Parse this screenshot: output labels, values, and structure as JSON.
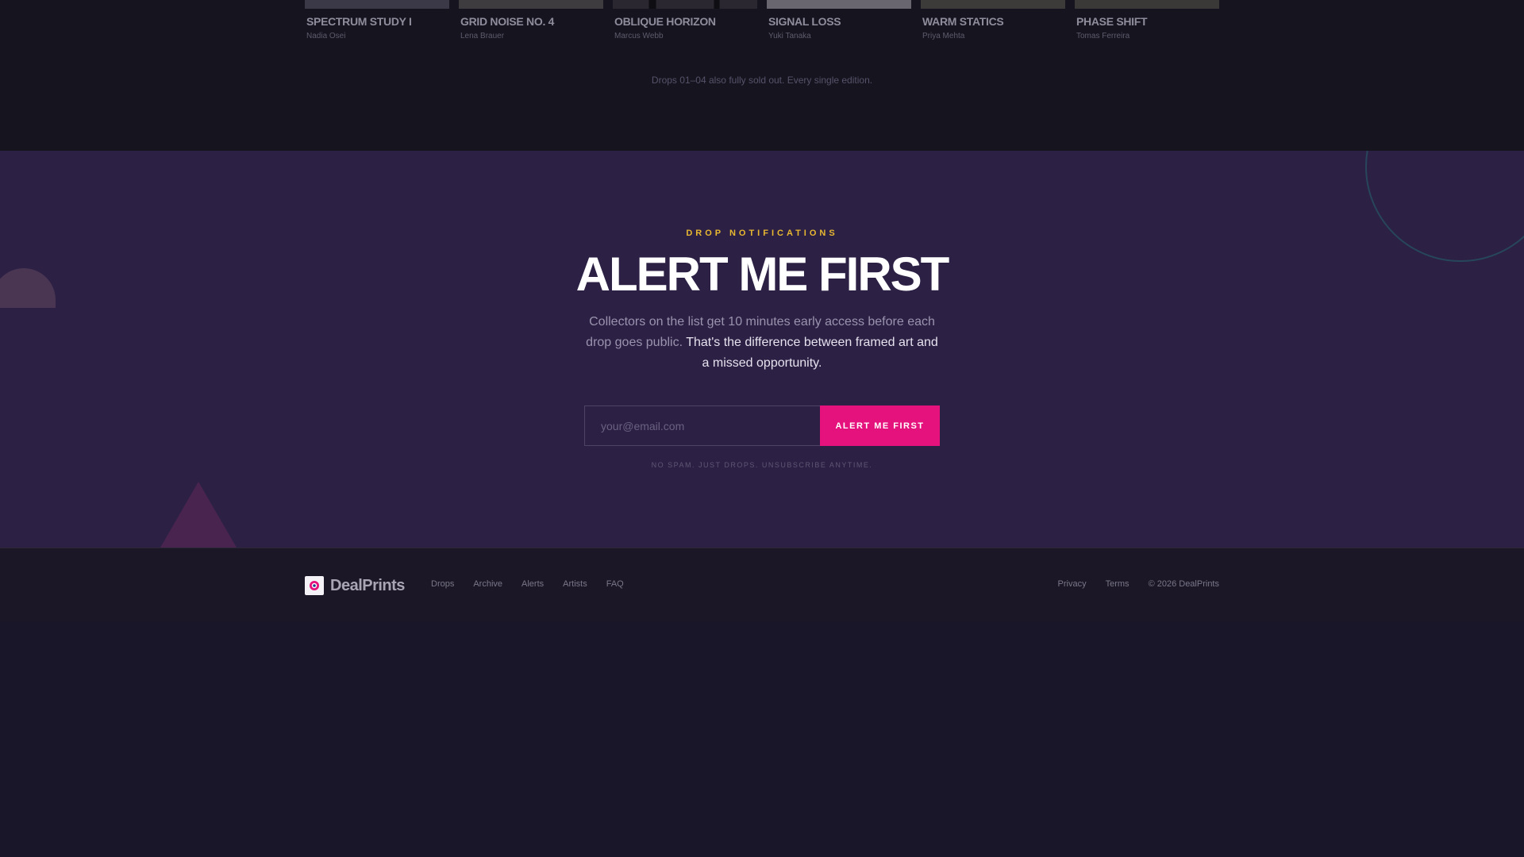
{
  "archive": {
    "cards": [
      {
        "title": "SPECTRUM STUDY I",
        "artist": "Nadia Osei",
        "thumb_color": "#3b3947"
      },
      {
        "title": "GRID NOISE NO. 4",
        "artist": "Lena Brauer",
        "thumb_color": "#3f3c40"
      },
      {
        "title": "OBLIQUE HORIZON",
        "artist": "Marcus Webb",
        "thumb_color": "#26232a"
      },
      {
        "title": "SIGNAL LOSS",
        "artist": "Yuki Tanaka",
        "thumb_color": "#69666f"
      },
      {
        "title": "WARM STATICS",
        "artist": "Priya Mehta",
        "thumb_color": "#3d3a3a"
      },
      {
        "title": "PHASE SHIFT",
        "artist": "Tomas Ferreira",
        "thumb_color": "#3a3938"
      }
    ],
    "note": "Drops 01–04 also fully sold out. Every single edition."
  },
  "alert": {
    "eyebrow": "DROP NOTIFICATIONS",
    "headline": "ALERT ME FIRST",
    "lead_muted": "Collectors on the list get 10 minutes early access before each drop goes public.",
    "lead_emphasis": "That's the difference between framed art and a missed opportunity.",
    "email_placeholder": "your@email.com",
    "cta_label": "ALERT ME FIRST",
    "fineprint": "NO SPAM. JUST DROPS. UNSUBSCRIBE ANYTIME.",
    "colors": {
      "accent": "#e5127d",
      "eyebrow": "#e8b830",
      "background": "#2c2045"
    }
  },
  "footer": {
    "brand": "DealPrints",
    "logo_icon": "eye-logo-icon",
    "nav": [
      "Drops",
      "Archive",
      "Alerts",
      "Artists",
      "FAQ"
    ],
    "privacy": "Privacy",
    "terms": "Terms",
    "copyright": "© 2026 DealPrints"
  }
}
